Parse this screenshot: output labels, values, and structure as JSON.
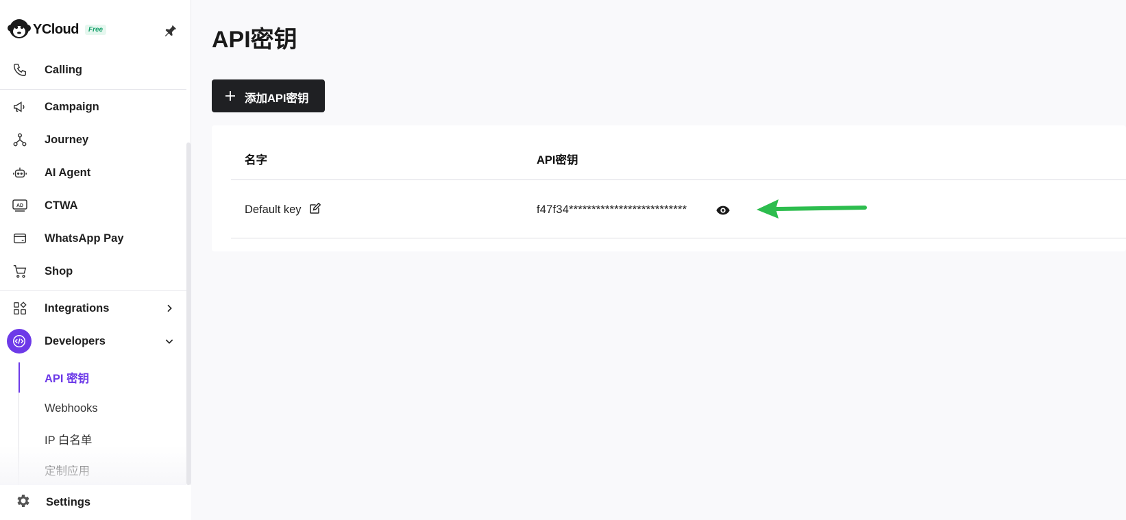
{
  "brand": {
    "name": "YCloud",
    "badge": "Free"
  },
  "sidebar": {
    "items": [
      {
        "label": "Calling",
        "icon": "phone-icon"
      },
      {
        "label": "Campaign",
        "icon": "megaphone-icon"
      },
      {
        "label": "Journey",
        "icon": "flow-icon"
      },
      {
        "label": "AI Agent",
        "icon": "robot-icon"
      },
      {
        "label": "CTWA",
        "icon": "ad-icon"
      },
      {
        "label": "WhatsApp Pay",
        "icon": "wallet-icon"
      },
      {
        "label": "Shop",
        "icon": "cart-icon"
      },
      {
        "label": "Integrations",
        "icon": "apps-icon"
      },
      {
        "label": "Developers",
        "icon": "code-icon"
      }
    ],
    "sub_items": [
      {
        "label": "API 密钥",
        "active": true
      },
      {
        "label": "Webhooks",
        "active": false
      },
      {
        "label": "IP 白名单",
        "active": false
      },
      {
        "label": "定制应用",
        "active": false
      }
    ],
    "settings_label": "Settings"
  },
  "main": {
    "title": "API密钥",
    "add_button_label": "添加API密钥",
    "table": {
      "headers": [
        "名字",
        "API密钥"
      ],
      "rows": [
        {
          "name": "Default key",
          "key": "f47f34**************************"
        }
      ]
    }
  },
  "colors": {
    "accent": "#6d3ae8",
    "button_bg": "#1f2023",
    "annotation_arrow": "#2dbd4e",
    "badge_text": "#14a06a"
  }
}
